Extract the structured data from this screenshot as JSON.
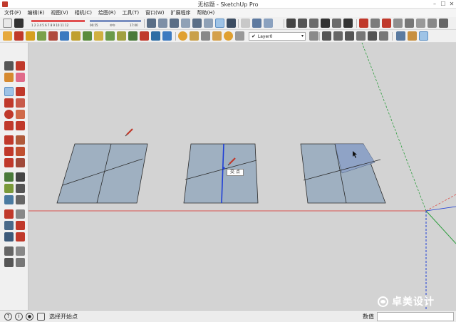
{
  "window": {
    "title": "无标题 - SketchUp Pro",
    "minimize": "–",
    "maximize": "☐",
    "close": "✕"
  },
  "menu": [
    "文件(F)",
    "编辑(E)",
    "视图(V)",
    "相机(C)",
    "绘图(R)",
    "工具(T)",
    "窗口(W)",
    "扩展程序",
    "帮助(H)"
  ],
  "shadow_gauge": {
    "month_ticks": "1 2 3 4 5 6 7 8 9 10 11 12",
    "time_start": "06:55",
    "noon": "中午",
    "time_end": "17:00"
  },
  "layer": {
    "check": "✔",
    "name": "Layer0",
    "caret": "▾"
  },
  "viewport": {
    "tooltip": "交 点"
  },
  "watermark": {
    "text": "卓美设计"
  },
  "status": {
    "icon_help": "?",
    "icon_info": "i",
    "icon_user": "●",
    "text": "选择开始点",
    "measure_label": "数值",
    "measure_value": ""
  },
  "colors": {
    "red_axis": "#d9534f",
    "green_axis": "#2e9e3e",
    "blue_axis": "#1f3fd6",
    "face": "#9fb0c1",
    "edge": "#2b2b2b"
  }
}
